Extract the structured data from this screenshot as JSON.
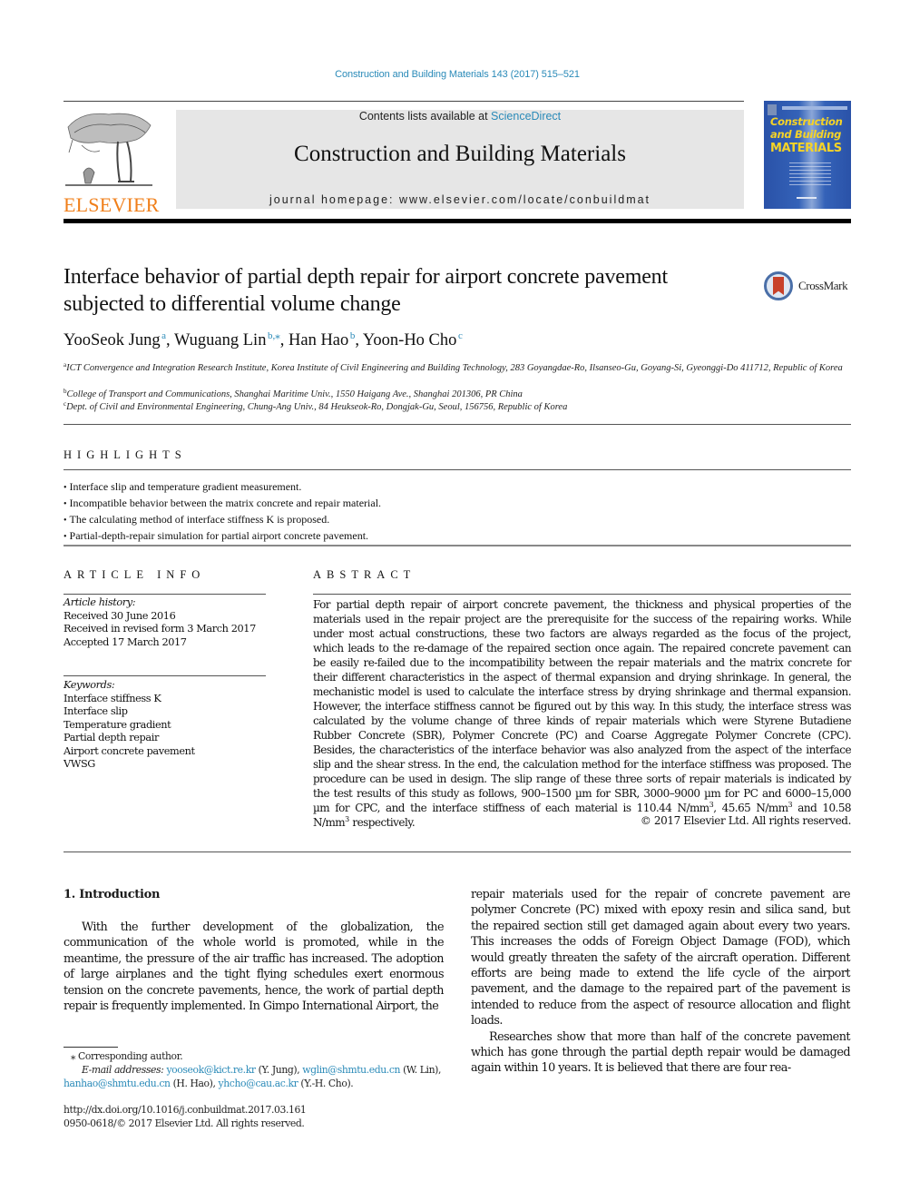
{
  "running_head": "Construction and Building Materials 143 (2017) 515–521",
  "masthead": {
    "publisher_logo_text": "ELSEVIER",
    "contents_prefix": "Contents lists available at ",
    "contents_link": "ScienceDirect",
    "journal_title": "Construction and Building Materials",
    "homepage_label": "journal homepage: www.elsevier.com/locate/conbuildmat",
    "cover": {
      "line1": "Construction",
      "line2": "and Building",
      "line3": "MATERIALS"
    }
  },
  "article": {
    "title": "Interface behavior of partial depth repair for airport concrete pavement subjected to differential volume change",
    "crossmark_label": "CrossMark",
    "authors": [
      {
        "name": "YooSeok Jung",
        "sup": "a",
        "sep": ", "
      },
      {
        "name": "Wuguang Lin",
        "sup": "b,⁎",
        "sep": ", "
      },
      {
        "name": "Han Hao",
        "sup": "b",
        "sep": ", "
      },
      {
        "name": "Yoon-Ho Cho",
        "sup": "c",
        "sep": ""
      }
    ],
    "affiliations": [
      {
        "key": "a",
        "text": "ICT Convergence and Integration Research Institute, Korea Institute of Civil Engineering and Building Technology, 283 Goyangdae-Ro, Ilsanseo-Gu, Goyang-Si, Gyeonggi-Do 411712, Republic of Korea"
      },
      {
        "key": "b",
        "text": "College of Transport and Communications, Shanghai Maritime Univ., 1550 Haigang Ave., Shanghai 201306, PR China"
      },
      {
        "key": "c",
        "text": "Dept. of Civil and Environmental Engineering, Chung-Ang Univ., 84 Heukseok-Ro, Dongjak-Gu, Seoul, 156756, Republic of Korea"
      }
    ]
  },
  "highlights": {
    "label": "HIGHLIGHTS",
    "items": [
      "Interface slip and temperature gradient measurement.",
      "Incompatible behavior between the matrix concrete and repair material.",
      "The calculating method of interface stiffness K is proposed.",
      "Partial-depth-repair simulation for partial airport concrete pavement."
    ]
  },
  "article_info": {
    "label": "ARTICLE INFO",
    "history_label": "Article history:",
    "history": [
      "Received 30 June 2016",
      "Received in revised form 3 March 2017",
      "Accepted 17 March 2017"
    ],
    "keywords_label": "Keywords:",
    "keywords": [
      "Interface stiffness K",
      "Interface slip",
      "Temperature gradient",
      "Partial depth repair",
      "Airport concrete pavement",
      "VWSG"
    ]
  },
  "abstract": {
    "label": "ABSTRACT",
    "text_before_sup1": "For partial depth repair of airport concrete pavement, the thickness and physical properties of the materials used in the repair project are the prerequisite for the success of the repairing works. While under most actual constructions, these two factors are always regarded as the focus of the project, which leads to the re-damage of the repaired section once again. The repaired concrete pavement can be easily re-failed due to the incompatibility between the repair materials and the matrix concrete for their different characteristics in the aspect of thermal expansion and drying shrinkage. In general, the mechanistic model is used to calculate the interface stress by drying shrinkage and thermal expansion. However, the interface stiffness cannot be figured out by this way. In this study, the interface stress was calculated by the volume change of three kinds of repair materials which were Styrene Butadiene Rubber Concrete (SBR), Polymer Concrete (PC) and Coarse Aggregate Polymer Concrete (CPC). Besides, the characteristics of the interface behavior was also analyzed from the aspect of the interface slip and the shear stress. In the end, the calculation method for the interface stiffness was proposed. The procedure can be used in design. The slip range of these three sorts of repair materials is indicated by the test results of this study as follows, 900–1500 µm for SBR, 3000–9000 µm for PC and 6000–15,000 µm for CPC, and the interface stiffness of each material is 110.44 N/mm",
    "sup": "3",
    "text_mid1": ", 45.65 N/mm",
    "text_mid2": " and 10.58 N/mm",
    "text_end": " respectively.",
    "copyright": "© 2017 Elsevier Ltd. All rights reserved."
  },
  "introduction": {
    "heading": "1. Introduction",
    "left_para": "With the further development of the globalization, the communication of the whole world is promoted, while in the meantime, the pressure of the air traffic has increased. The adoption of large airplanes and the tight flying schedules exert enormous tension on the concrete pavements, hence, the work of partial depth repair is frequently implemented. In Gimpo International Airport, the",
    "right_para1": "repair materials used for the repair of concrete pavement are polymer Concrete (PC) mixed with epoxy resin and silica sand, but the repaired section still get damaged again about every two years. This increases the odds of Foreign Object Damage (FOD), which would greatly threaten the safety of the aircraft operation. Different efforts are being made to extend the life cycle of the airport pavement, and the damage to the repaired part of the pavement is intended to reduce from the aspect of resource allocation and flight loads.",
    "right_para2": "Researches show that more than half of the concrete pavement which has gone through the partial depth repair would be damaged again within 10 years. It is believed that there are four rea-"
  },
  "footnotes": {
    "corresponding": "⁎ Corresponding author.",
    "email_label": "E-mail addresses: ",
    "emails": [
      {
        "address": "yooseok@kict.re.kr",
        "who": " (Y. Jung), "
      },
      {
        "address": "wglin@shmtu.edu.cn",
        "who": " (W. Lin),"
      },
      {
        "address": "hanhao@shmtu.edu.cn",
        "who": " (H. Hao), "
      },
      {
        "address": "yhcho@cau.ac.kr",
        "who": " (Y.-H. Cho)."
      }
    ],
    "doi": "http://dx.doi.org/10.1016/j.conbuildmat.2017.03.161",
    "issn": "0950-0618/© 2017 Elsevier Ltd. All rights reserved."
  },
  "colors": {
    "link": "#2a8ab8",
    "elsevier_orange": "#f07f1a",
    "masthead_gray": "#e6e6e6",
    "cover_blue": "#2a52a8",
    "cover_yellow": "#f5d327"
  }
}
